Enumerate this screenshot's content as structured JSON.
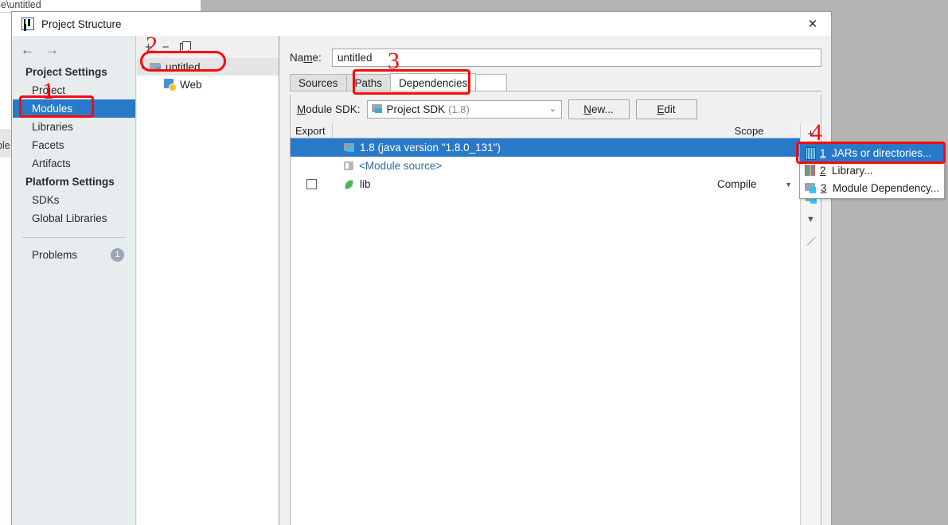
{
  "background_window": {
    "title_fragment": "de\\untitled",
    "left_tab_fragment": "ble"
  },
  "dialog": {
    "title": "Project Structure",
    "app_icon": "intellij-idea-icon",
    "close_icon": "✕"
  },
  "sidebar": {
    "back_icon": "←",
    "forward_icon": "→",
    "sections": [
      {
        "header": "Project Settings",
        "items": [
          {
            "label": "Project",
            "selected": false
          },
          {
            "label": "Modules",
            "selected": true
          },
          {
            "label": "Libraries",
            "selected": false
          },
          {
            "label": "Facets",
            "selected": false
          },
          {
            "label": "Artifacts",
            "selected": false
          }
        ]
      },
      {
        "header": "Platform Settings",
        "items": [
          {
            "label": "SDKs",
            "selected": false
          },
          {
            "label": "Global Libraries",
            "selected": false
          }
        ]
      }
    ],
    "problems": {
      "label": "Problems",
      "count": "1"
    }
  },
  "module_tree": {
    "toolbar": {
      "add_icon": "+",
      "remove_icon": "−",
      "copy_icon": "copy-icon"
    },
    "nodes": [
      {
        "label": "untitled",
        "icon": "module-icon",
        "expanded": true,
        "selected": true
      },
      {
        "label": "Web",
        "icon": "web-facet-icon",
        "child": true
      }
    ]
  },
  "main": {
    "name_label_pre": "Na",
    "name_label_mnemonic": "m",
    "name_label_post": "e:",
    "name_value": "untitled",
    "tabs": [
      {
        "label": "Sources",
        "active": false
      },
      {
        "label": "Paths",
        "active": false
      },
      {
        "label": "Dependencies",
        "active": true
      }
    ],
    "sdk": {
      "label_pre": "",
      "label_mnemonic": "M",
      "label_post": "odule SDK:",
      "selected": "Project SDK",
      "selected_version": "(1.8)",
      "icon": "sdk-icon",
      "dropdown_icon": "chevron-down-icon",
      "new_button_pre": "",
      "new_button_mnemonic": "N",
      "new_button_post": "ew...",
      "edit_button_pre": "",
      "edit_button_mnemonic": "E",
      "edit_button_post": "dit"
    },
    "table": {
      "columns": [
        "Export",
        "",
        "Scope"
      ],
      "rows": [
        {
          "export_checkbox": false,
          "show_checkbox": false,
          "icon": "sdk-icon",
          "name": "1.8 (java version \"1.8.0_131\")",
          "scope": "",
          "selected": true,
          "link": false
        },
        {
          "export_checkbox": false,
          "show_checkbox": false,
          "icon": "module-source-icon",
          "name": "<Module source>",
          "scope": "",
          "selected": false,
          "link": true
        },
        {
          "export_checkbox": false,
          "show_checkbox": true,
          "icon": "library-leaf-icon",
          "name": "lib",
          "scope": "Compile",
          "selected": false,
          "link": false
        }
      ]
    },
    "side_toolbar": [
      {
        "icon": "plus-icon",
        "glyph": "+"
      },
      {
        "icon": "jar-icon",
        "glyph": ""
      },
      {
        "icon": "library-icon",
        "glyph": ""
      },
      {
        "icon": "module-dependency-icon",
        "glyph": ""
      },
      {
        "icon": "chevron-down-icon",
        "glyph": "▼"
      },
      {
        "icon": "edit-pencil-icon",
        "glyph": ""
      }
    ]
  },
  "popup_menu": {
    "items": [
      {
        "mnemonic": "1",
        "label": "JARs or directories...",
        "icon": "jar-icon",
        "highlighted": true
      },
      {
        "mnemonic": "2",
        "label": "Library...",
        "icon": "library-icon",
        "highlighted": false
      },
      {
        "mnemonic": "3",
        "label": "Module Dependency...",
        "icon": "module-dependency-icon",
        "highlighted": false
      }
    ]
  },
  "annotations": {
    "color": "#fb0a0a",
    "markers": [
      {
        "number": "1",
        "target": "Modules sidebar item"
      },
      {
        "number": "2",
        "target": "untitled module tree node"
      },
      {
        "number": "3",
        "target": "Dependencies tab"
      },
      {
        "number": "4",
        "target": "JARs or directories menu item"
      }
    ]
  }
}
